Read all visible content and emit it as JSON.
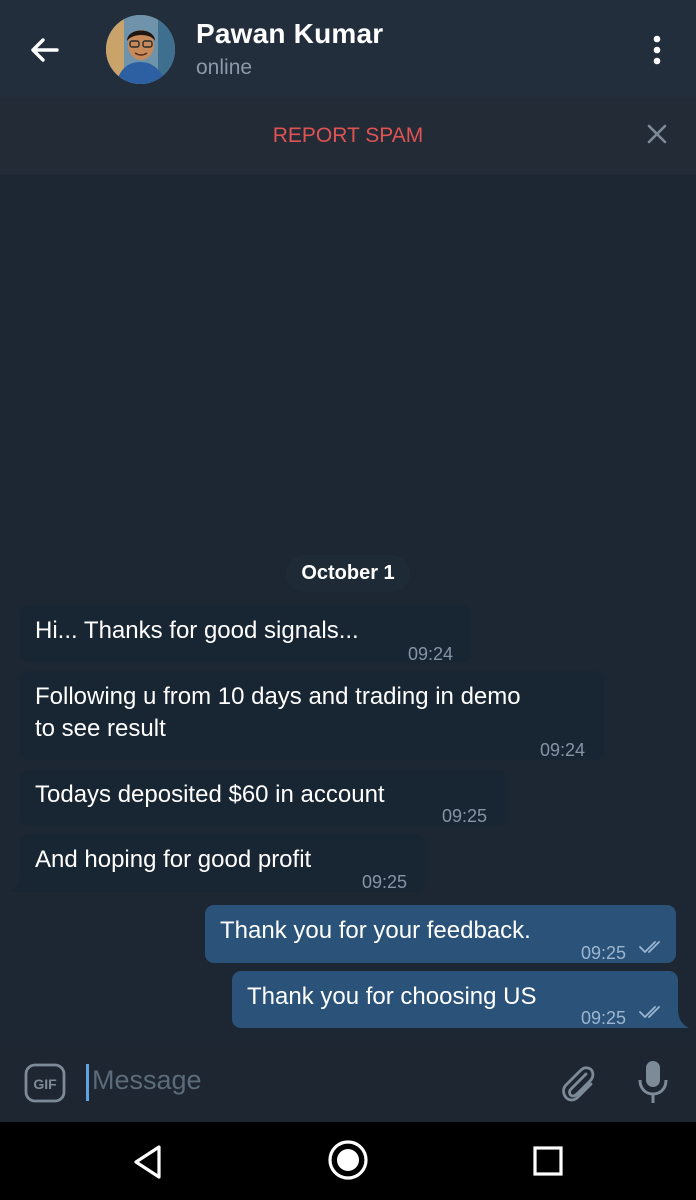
{
  "header": {
    "back_icon": "arrow-left-icon",
    "contact_name": "Pawan Kumar",
    "status": "online",
    "menu_icon": "more-vertical-icon"
  },
  "spam_bar": {
    "label": "REPORT SPAM",
    "close_icon": "close-icon"
  },
  "date_chip": "October 1",
  "messages": [
    {
      "direction": "in",
      "text": "Hi... Thanks for good signals...",
      "time": "09:24"
    },
    {
      "direction": "in",
      "text": "Following u from 10 days and trading in demo\nto see result",
      "time": "09:24"
    },
    {
      "direction": "in",
      "text": "Todays deposited $60 in account",
      "time": "09:25"
    },
    {
      "direction": "in",
      "text": "And hoping for good profit",
      "time": "09:25"
    },
    {
      "direction": "out",
      "text": "Thank you for your feedback.",
      "time": "09:25",
      "status": "read-double-check-icon"
    },
    {
      "direction": "out",
      "text": "Thank you for choosing US",
      "time": "09:25",
      "status": "read-double-check-icon"
    }
  ],
  "composer": {
    "gif_icon": "gif-icon",
    "placeholder": "Message",
    "attach_icon": "paperclip-icon",
    "mic_icon": "microphone-icon"
  },
  "colors": {
    "background": "#1d2733",
    "appbar": "#232e3c",
    "incoming_bubble": "#182533",
    "outgoing_bubble": "#2b5278",
    "spam_text": "#e05353"
  }
}
